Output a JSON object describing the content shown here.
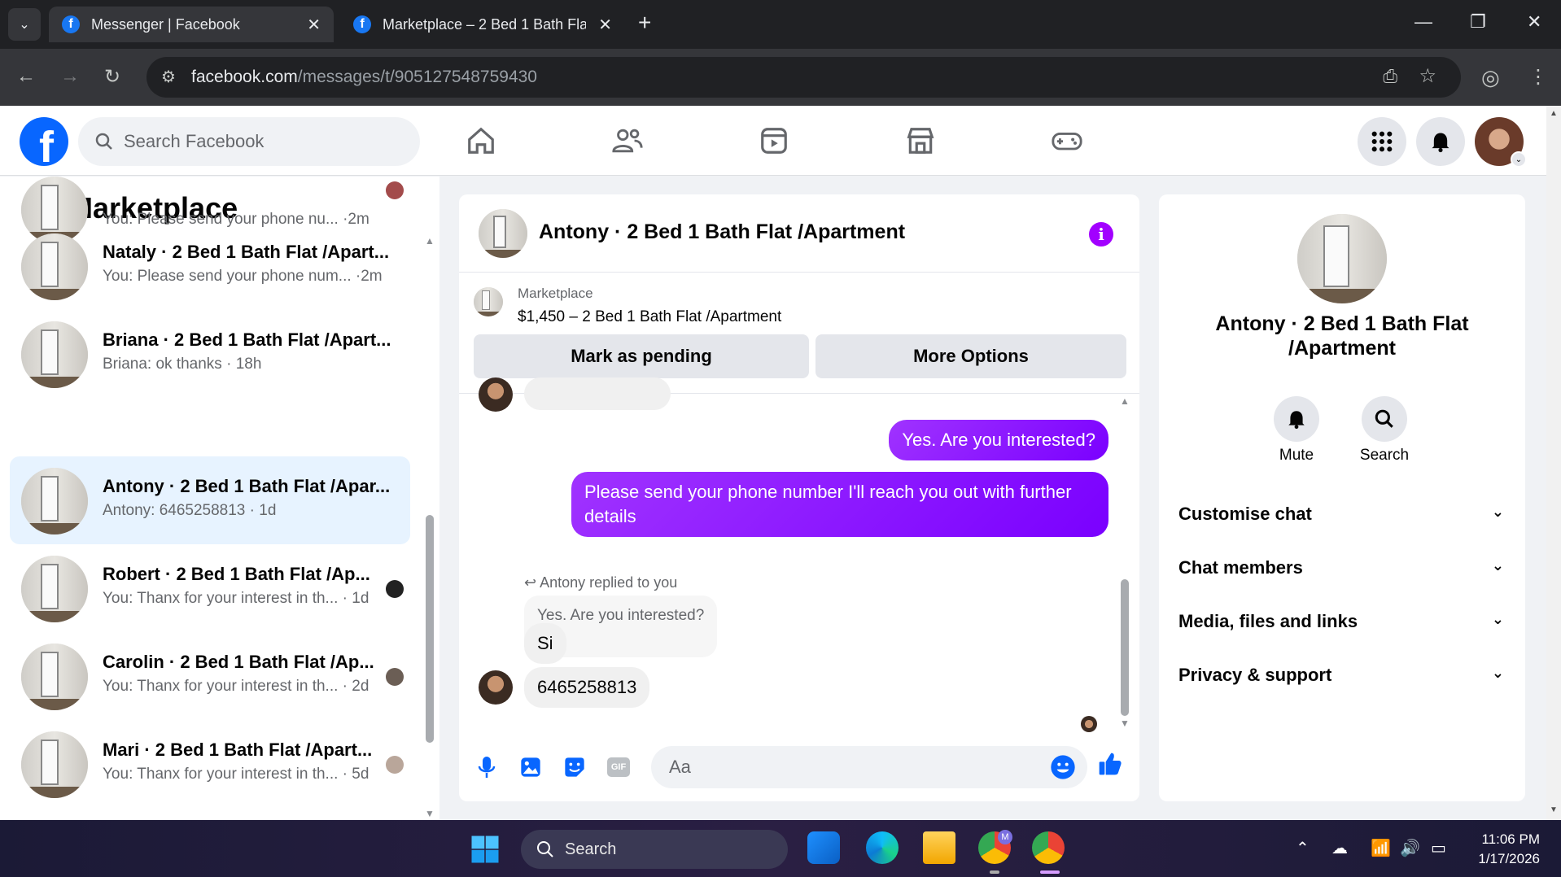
{
  "browser": {
    "tabs": [
      {
        "title": "Messenger | Facebook",
        "active": true
      },
      {
        "title": "Marketplace – 2 Bed 1 Bath Flat",
        "active": false
      }
    ],
    "url_host": "facebook.com",
    "url_path": "/messages/t/905127548759430"
  },
  "fb": {
    "search_placeholder": "Search Facebook"
  },
  "left": {
    "title": "Marketplace",
    "conversations": [
      {
        "name": "",
        "preview": "You: Please send your phone nu... ·2m",
        "selected": false
      },
      {
        "name": "Nataly · 2 Bed 1 Bath Flat /Apart...",
        "preview": "You: Please send your phone num... ·2m",
        "selected": false
      },
      {
        "name": "Briana · 2 Bed 1 Bath Flat /Apart...",
        "preview": "Briana: ok thanks · 18h",
        "selected": false
      },
      {
        "name": "Antony · 2 Bed 1 Bath Flat /Apar...",
        "preview": "Antony: 6465258813 · 1d",
        "selected": true
      },
      {
        "name": "Robert · 2 Bed 1 Bath Flat /Ap...",
        "preview": "You: Thanx for your interest in th... · 1d",
        "selected": false
      },
      {
        "name": "Carolin · 2 Bed 1 Bath Flat /Ap...",
        "preview": "You: Thanx for your interest in th... · 2d",
        "selected": false
      },
      {
        "name": "Mari · 2 Bed 1 Bath Flat /Apart...",
        "preview": "You: Thanx for your interest in th... · 5d",
        "selected": false
      }
    ]
  },
  "chat": {
    "header_name": "Antony · 2 Bed 1 Bath Flat /Apartment",
    "marketplace_label": "Marketplace",
    "listing": "$1,450 – 2 Bed 1 Bath Flat /Apartment",
    "mark_pending": "Mark as pending",
    "more_options": "More Options",
    "messages": {
      "out1": "Yes. Are you interested?",
      "out2": "Please send your phone number  I'll reach you out with further details",
      "reply_note": "Antony replied to you",
      "quoted": "Yes. Are you interested?",
      "in1": "Si",
      "in2": "6465258813"
    },
    "input_placeholder": "Aa"
  },
  "right": {
    "name": "Antony · 2 Bed 1 Bath Flat /Apartment",
    "mute": "Mute",
    "search": "Search",
    "sections": [
      "Customise chat",
      "Chat members",
      "Media, files and links",
      "Privacy & support"
    ]
  },
  "taskbar": {
    "search": "Search",
    "time": "11:06 PM",
    "date": "1/17/2026"
  }
}
